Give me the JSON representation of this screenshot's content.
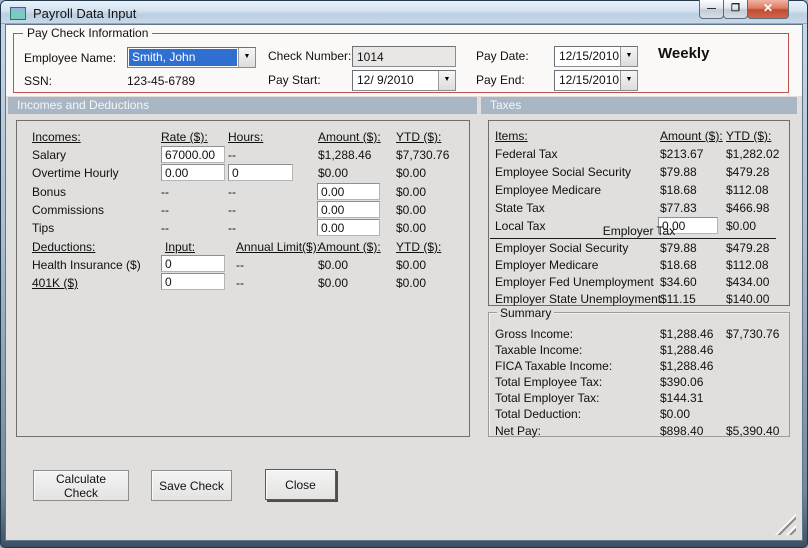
{
  "window": {
    "title": "Payroll Data Input",
    "minimize_glyph": "—",
    "maximize_glyph": "❐",
    "close_glyph": "✕"
  },
  "info": {
    "legend": "Pay Check Information",
    "employee_name_label": "Employee Name:",
    "employee_name_value": "Smith, John",
    "ssn_label": "SSN:",
    "ssn_value": "123-45-6789",
    "check_number_label": "Check Number:",
    "check_number_value": "1014",
    "pay_start_label": "Pay Start:",
    "pay_start_value": "12/ 9/2010",
    "pay_date_label": "Pay Date:",
    "pay_date_value": "12/15/2010",
    "pay_end_label": "Pay End:",
    "pay_end_value": "12/15/2010",
    "frequency": "Weekly"
  },
  "left_panel": {
    "header": "Incomes and Deductions"
  },
  "right_panel": {
    "header": "Taxes"
  },
  "inc": {
    "headers": [
      "Incomes:",
      "Rate ($):",
      "Hours:",
      "Amount ($):",
      "YTD ($):"
    ],
    "rows": [
      {
        "label": "Salary",
        "rate": "67000.00",
        "hours": "--",
        "amount": "$1,288.46",
        "ytd": "$7,730.76"
      },
      {
        "label": "Overtime Hourly",
        "rate": "0.00",
        "hours": "0",
        "amount": "$0.00",
        "ytd": "$0.00"
      },
      {
        "label": "Bonus",
        "rate": "--",
        "hours": "--",
        "amount": "0.00",
        "ytd": "$0.00"
      },
      {
        "label": "Commissions",
        "rate": "--",
        "hours": "--",
        "amount": "0.00",
        "ytd": "$0.00"
      },
      {
        "label": "Tips",
        "rate": "--",
        "hours": "--",
        "amount": "0.00",
        "ytd": "$0.00"
      }
    ]
  },
  "ded": {
    "headers": [
      "Deductions:",
      "Input:",
      "Annual Limit($):",
      "Amount ($):",
      "YTD ($):"
    ],
    "rows": [
      {
        "label": "Health Insurance ($)",
        "input": "0",
        "limit": "--",
        "amount": "$0.00",
        "ytd": "$0.00"
      },
      {
        "label": "401K ($)",
        "input": "0",
        "limit": "--",
        "amount": "$0.00",
        "ytd": "$0.00"
      }
    ]
  },
  "tax": {
    "headers": [
      "Items:",
      "Amount ($):",
      "YTD ($):"
    ],
    "rows": [
      {
        "label": "Federal Tax",
        "amount": "$213.67",
        "ytd": "$1,282.02"
      },
      {
        "label": "Employee Social Security",
        "amount": "$79.88",
        "ytd": "$479.28"
      },
      {
        "label": "Employee Medicare",
        "amount": "$18.68",
        "ytd": "$112.08"
      },
      {
        "label": "State Tax",
        "amount": "$77.83",
        "ytd": "$466.98"
      },
      {
        "label": "Local Tax",
        "amount": "0.00",
        "ytd": "$0.00"
      }
    ]
  },
  "emp": {
    "header": "Employer Tax",
    "rows": [
      {
        "label": "Employer Social Security",
        "amount": "$79.88",
        "ytd": "$479.28"
      },
      {
        "label": "Employer Medicare",
        "amount": "$18.68",
        "ytd": "$112.08"
      },
      {
        "label": "Employer Fed Unemployment",
        "amount": "$34.60",
        "ytd": "$434.00"
      },
      {
        "label": "Employer State Unemployment",
        "amount": "$11.15",
        "ytd": "$140.00"
      }
    ]
  },
  "sum": {
    "legend": "Summary",
    "rows": [
      {
        "label": "Gross Income:",
        "amount": "$1,288.46",
        "ytd": "$7,730.76"
      },
      {
        "label": "Taxable Income:",
        "amount": "$1,288.46",
        "ytd": ""
      },
      {
        "label": "FICA Taxable Income:",
        "amount": "$1,288.46",
        "ytd": ""
      },
      {
        "label": "Total Employee Tax:",
        "amount": "$390.06",
        "ytd": ""
      },
      {
        "label": "Total Employer Tax:",
        "amount": "$144.31",
        "ytd": ""
      },
      {
        "label": "Total Deduction:",
        "amount": "$0.00",
        "ytd": ""
      },
      {
        "label": "Net Pay:",
        "amount": "$898.40",
        "ytd": "$5,390.40"
      }
    ]
  },
  "buttons": {
    "calculate": "Calculate Check",
    "save": "Save Check",
    "close": "Close"
  },
  "colors": {
    "group_border": "#c0504d",
    "panel_header": "#a9b7c4",
    "selection": "#2e6fd0",
    "client_bg": "#e0dfde",
    "top_bg": "#fbf9f8",
    "close_button": "#c04a30"
  }
}
